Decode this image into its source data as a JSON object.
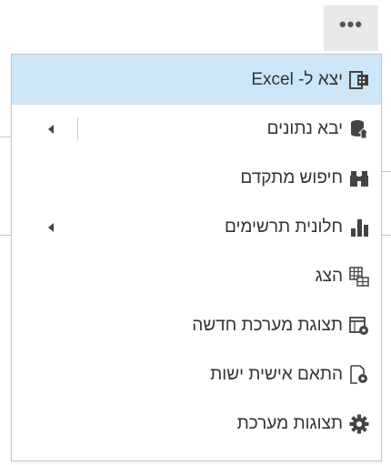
{
  "toolbar": {
    "more_label": "•••"
  },
  "menu": {
    "items": [
      {
        "label": "יצא ל- Excel",
        "icon": "excel-export-icon",
        "has_submenu": false,
        "highlighted": true
      },
      {
        "label": "יבא נתונים",
        "icon": "import-data-icon",
        "has_submenu": true,
        "highlighted": false
      },
      {
        "label": "חיפוש מתקדם",
        "icon": "binoculars-icon",
        "has_submenu": false,
        "highlighted": false
      },
      {
        "label": "חלונית תרשימים",
        "icon": "bar-chart-icon",
        "has_submenu": true,
        "highlighted": false
      },
      {
        "label": "הצג",
        "icon": "view-grid-icon",
        "has_submenu": false,
        "highlighted": false
      },
      {
        "label": "תצוגת מערכת חדשה",
        "icon": "new-system-view-icon",
        "has_submenu": false,
        "highlighted": false
      },
      {
        "label": "התאם אישית ישות",
        "icon": "customize-entity-icon",
        "has_submenu": false,
        "highlighted": false
      },
      {
        "label": "תצוגות מערכת",
        "icon": "gear-icon",
        "has_submenu": false,
        "highlighted": false
      }
    ]
  },
  "colors": {
    "highlight": "#cde6f7",
    "text": "#333333",
    "icon": "#444444"
  }
}
